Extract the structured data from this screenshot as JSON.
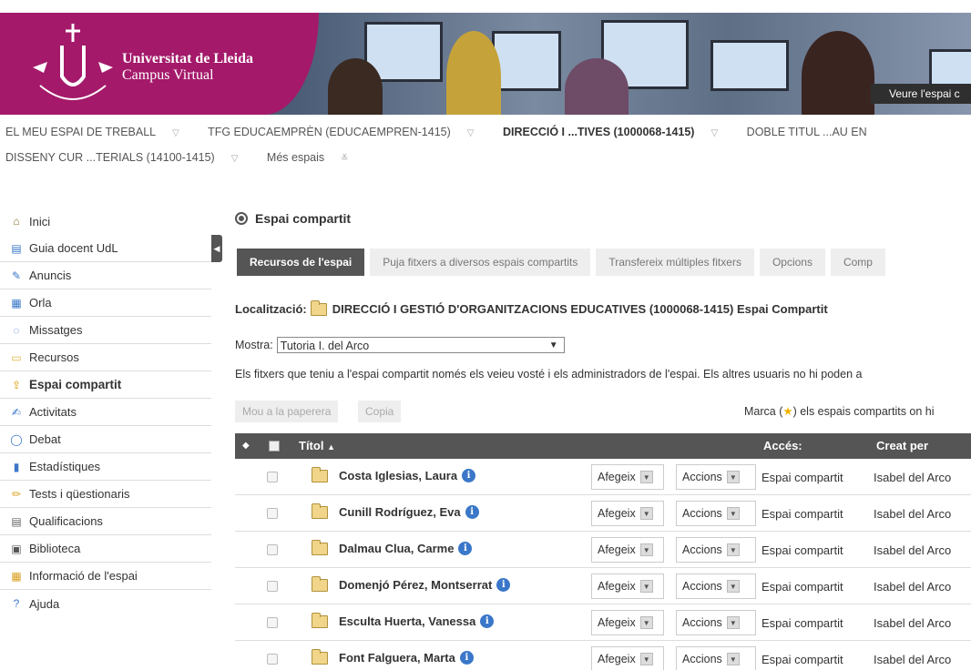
{
  "header": {
    "university": "Universitat de Lleida",
    "campus": "Campus Virtual",
    "view_space_button": "Veure l'espai c"
  },
  "nav": {
    "row1": [
      {
        "label": "EL MEU ESPAI DE TREBALL",
        "selected": false
      },
      {
        "label": "TFG EDUCAEMPRÈN (EDUCAEMPREN-1415)",
        "selected": false
      },
      {
        "label": "DIRECCIÓ I ...TIVES (1000068-1415)",
        "selected": true
      },
      {
        "label": "DOBLE TITUL ...AU EN",
        "selected": false
      }
    ],
    "row2": [
      {
        "label": "DISSENY CUR ...TERIALS (14100-1415)"
      },
      {
        "label": "Més espais"
      }
    ]
  },
  "sidebar": {
    "items": [
      {
        "label": "Inici",
        "icon": "home-icon"
      },
      {
        "label": "Guia docent UdL",
        "icon": "guide-icon"
      },
      {
        "label": "Anuncis",
        "icon": "announcement-icon"
      },
      {
        "label": "Orla",
        "icon": "orla-icon"
      },
      {
        "label": "Missatges",
        "icon": "message-icon"
      },
      {
        "label": "Recursos",
        "icon": "folder-icon"
      },
      {
        "label": "Espai compartit",
        "icon": "shared-space-icon"
      },
      {
        "label": "Activitats",
        "icon": "activity-icon"
      },
      {
        "label": "Debat",
        "icon": "debate-icon"
      },
      {
        "label": "Estadístiques",
        "icon": "stats-icon"
      },
      {
        "label": "Tests i qüestionaris",
        "icon": "pencil-icon"
      },
      {
        "label": "Qualificacions",
        "icon": "grades-icon"
      },
      {
        "label": "Biblioteca",
        "icon": "library-icon"
      },
      {
        "label": "Informació de l'espai",
        "icon": "info-space-icon"
      },
      {
        "label": "Ajuda",
        "icon": "help-icon"
      }
    ]
  },
  "main": {
    "title": "Espai compartit",
    "tabs": [
      {
        "label": "Recursos de l'espai"
      },
      {
        "label": "Puja fitxers a diversos espais compartits"
      },
      {
        "label": "Transfereix múltiples fitxers"
      },
      {
        "label": "Opcions"
      },
      {
        "label": "Comp"
      }
    ],
    "location_label": "Localització:",
    "location_value": "DIRECCIÓ I GESTIÓ D'ORGANITZACIONS EDUCATIVES (1000068-1415) Espai Compartit",
    "show_label": "Mostra:",
    "show_value": "Tutoria I. del Arco",
    "info_text": "Els fitxers que teniu a l'espai compartit només els veieu vosté i els administradors de l'espai. Els altres usuaris no hi poden a",
    "trash_button": "Mou a la paperera",
    "copy_button": "Copia",
    "mark_text_pre": "Marca (",
    "mark_text_post": ") els espais compartits on hi",
    "table": {
      "col_title": "Títol",
      "col_access": "Accés:",
      "col_created": "Creat per",
      "add_label": "Afegeix",
      "actions_label": "Accions",
      "rows": [
        {
          "name": "Costa Iglesias, Laura",
          "access": "Espai compartit",
          "created_by": "Isabel del Arco"
        },
        {
          "name": "Cunill Rodríguez, Eva",
          "access": "Espai compartit",
          "created_by": "Isabel del Arco"
        },
        {
          "name": "Dalmau Clua, Carme",
          "access": "Espai compartit",
          "created_by": "Isabel del Arco"
        },
        {
          "name": "Domenjó Pérez, Montserrat",
          "access": "Espai compartit",
          "created_by": "Isabel del Arco"
        },
        {
          "name": "Esculta Huerta, Vanessa",
          "access": "Espai compartit",
          "created_by": "Isabel del Arco"
        },
        {
          "name": "Font Falguera, Marta",
          "access": "Espai compartit",
          "created_by": "Isabel del Arco"
        }
      ]
    }
  }
}
